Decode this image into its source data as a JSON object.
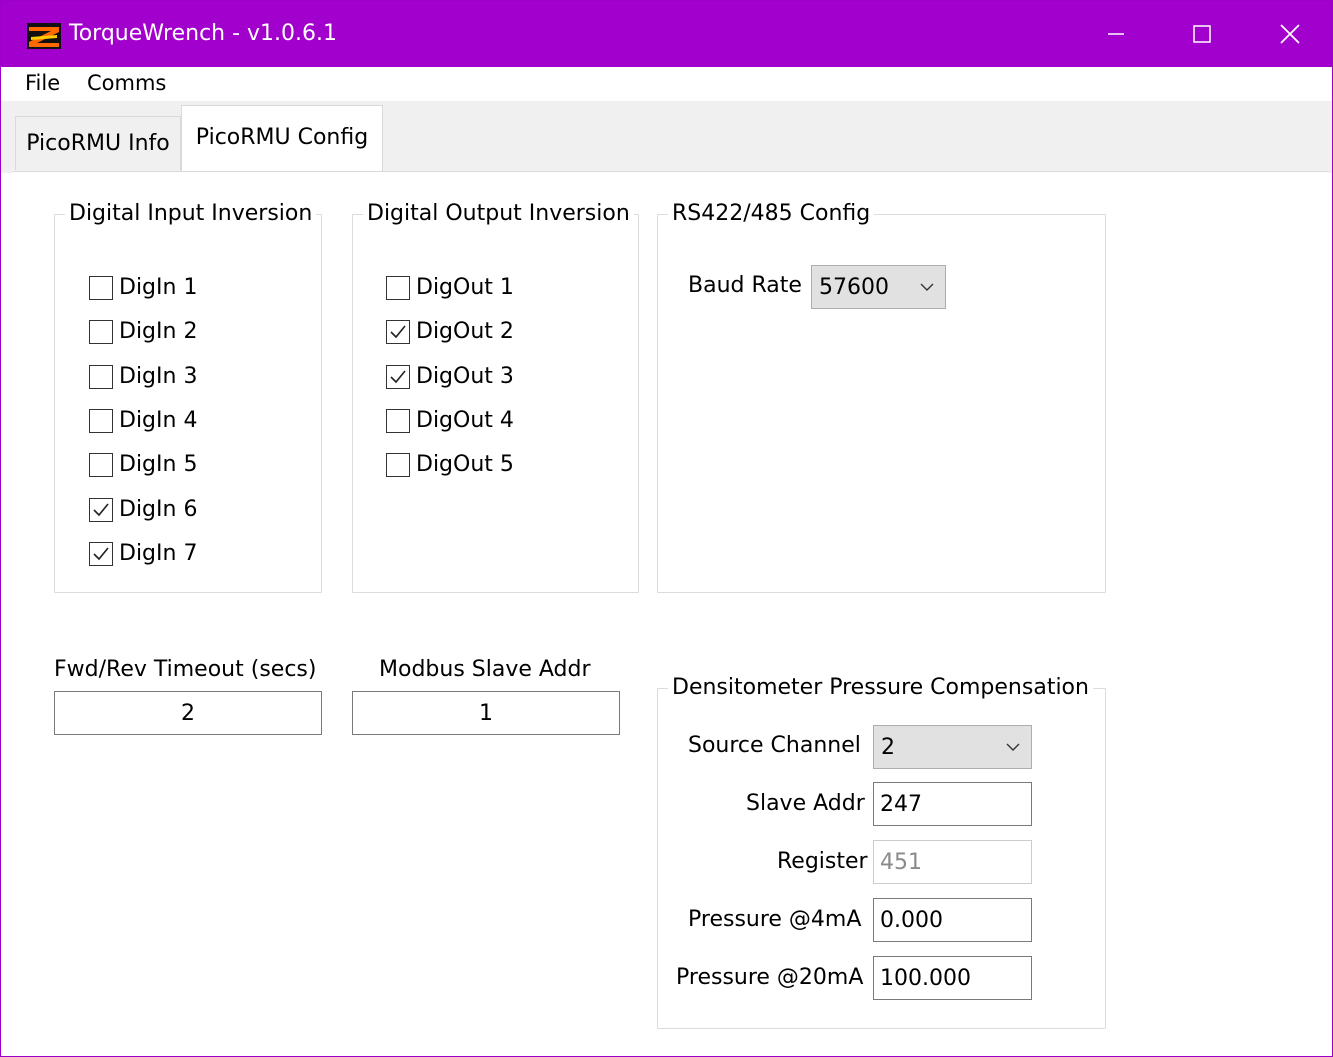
{
  "window": {
    "title": "TorqueWrench - v1.0.6.1",
    "accent_color": "#a200cc",
    "minimize_icon": "minimize-icon",
    "maximize_icon": "maximize-icon",
    "close_icon": "close-icon"
  },
  "menu": {
    "items": [
      "File",
      "Comms"
    ]
  },
  "tabs": [
    {
      "label": "PicoRMU Info",
      "active": false
    },
    {
      "label": "PicoRMU Config",
      "active": true
    }
  ],
  "digital_input_inversion": {
    "title": "Digital Input Inversion",
    "items": [
      {
        "label": "DigIn 1",
        "checked": false
      },
      {
        "label": "DigIn 2",
        "checked": false
      },
      {
        "label": "DigIn 3",
        "checked": false
      },
      {
        "label": "DigIn 4",
        "checked": false
      },
      {
        "label": "DigIn 5",
        "checked": false
      },
      {
        "label": "DigIn 6",
        "checked": true
      },
      {
        "label": "DigIn 7",
        "checked": true
      }
    ]
  },
  "digital_output_inversion": {
    "title": "Digital Output Inversion",
    "items": [
      {
        "label": "DigOut 1",
        "checked": false
      },
      {
        "label": "DigOut 2",
        "checked": true
      },
      {
        "label": "DigOut 3",
        "checked": true
      },
      {
        "label": "DigOut 4",
        "checked": false
      },
      {
        "label": "DigOut 5",
        "checked": false
      }
    ]
  },
  "rs_config": {
    "title": "RS422/485 Config",
    "baud_label": "Baud Rate",
    "baud_value": "57600"
  },
  "fwd_rev": {
    "label": "Fwd/Rev Timeout (secs)",
    "value": "2"
  },
  "modbus": {
    "label": "Modbus Slave Addr",
    "value": "1"
  },
  "densitometer": {
    "title": "Densitometer Pressure Compensation",
    "source_channel_label": "Source Channel",
    "source_channel_value": "2",
    "slave_addr_label": "Slave Addr",
    "slave_addr_value": "247",
    "register_label": "Register",
    "register_value": "451",
    "pressure_4ma_label": "Pressure @4mA",
    "pressure_4ma_value": "0.000",
    "pressure_20ma_label": "Pressure @20mA",
    "pressure_20ma_value": "100.000"
  }
}
